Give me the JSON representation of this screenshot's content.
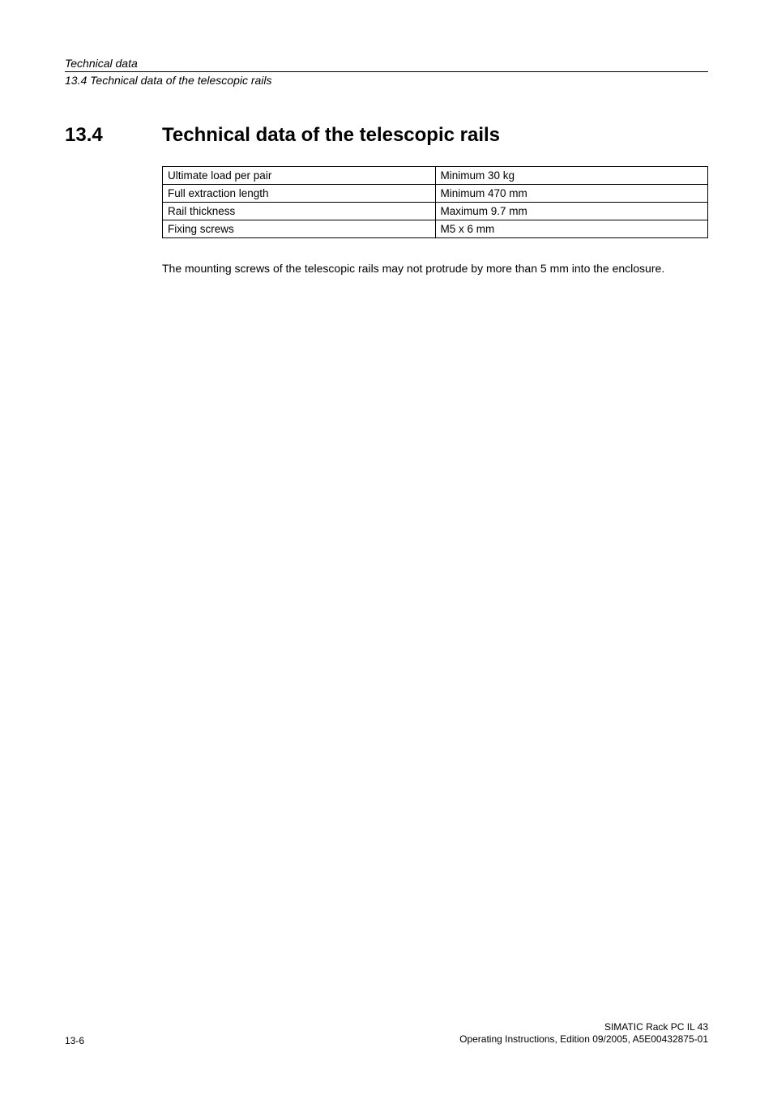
{
  "header": {
    "section": "Technical data",
    "subsection": "13.4 Technical data of the telescopic rails"
  },
  "heading": {
    "number": "13.4",
    "title": "Technical data of the telescopic rails"
  },
  "table": {
    "rows": [
      {
        "label": "Ultimate load per pair",
        "value": "Minimum 30 kg"
      },
      {
        "label": "Full extraction length",
        "value": "Minimum 470 mm"
      },
      {
        "label": "Rail thickness",
        "value": "Maximum 9.7 mm"
      },
      {
        "label": "Fixing screws",
        "value": "M5 x 6 mm"
      }
    ]
  },
  "body": {
    "paragraph": "The mounting screws of the telescopic rails may not protrude by more than 5 mm into the enclosure."
  },
  "footer": {
    "page_number": "13-6",
    "product": "SIMATIC Rack PC IL 43",
    "doc_info": "Operating Instructions, Edition 09/2005, A5E00432875-01"
  }
}
